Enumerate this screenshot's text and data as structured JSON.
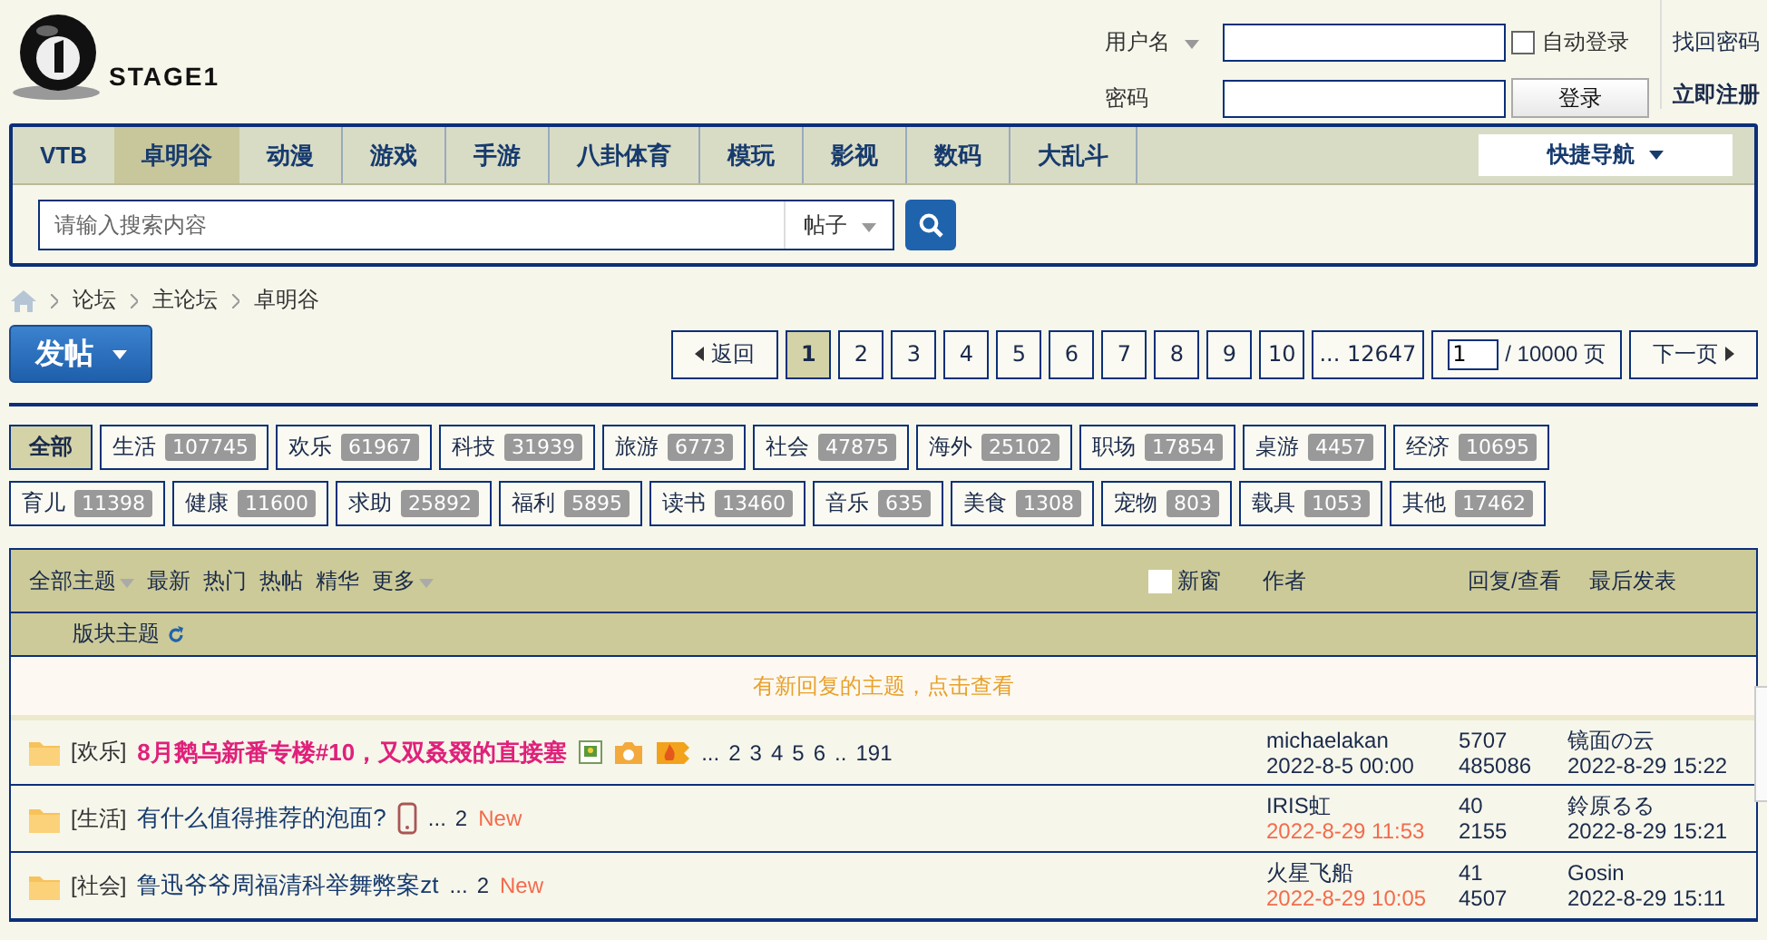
{
  "site": {
    "logo_text": "STAGE1"
  },
  "login": {
    "username_label": "用户名",
    "password_label": "密码",
    "remember_label": "自动登录",
    "remember_checked": false,
    "login_button": "登录",
    "forgot_link": "找回密码",
    "register_link": "立即注册"
  },
  "nav": {
    "items": [
      {
        "label": "VTB",
        "selected": false
      },
      {
        "label": "卓明谷",
        "selected": true
      },
      {
        "label": "动漫",
        "selected": false
      },
      {
        "label": "游戏",
        "selected": false
      },
      {
        "label": "手游",
        "selected": false
      },
      {
        "label": "八卦体育",
        "selected": false
      },
      {
        "label": "模玩",
        "selected": false
      },
      {
        "label": "影视",
        "selected": false
      },
      {
        "label": "数码",
        "selected": false
      },
      {
        "label": "大乱斗",
        "selected": false
      }
    ],
    "quick_nav": "快捷导航"
  },
  "search": {
    "placeholder": "请输入搜索内容",
    "scope": "帖子"
  },
  "breadcrumb": [
    "论坛",
    "主论坛",
    "卓明谷"
  ],
  "post_button": "发帖",
  "pagination": {
    "back": "返回",
    "pages": [
      {
        "label": "1",
        "selected": true
      },
      {
        "label": "2",
        "selected": false
      },
      {
        "label": "3",
        "selected": false
      },
      {
        "label": "4",
        "selected": false
      },
      {
        "label": "5",
        "selected": false
      },
      {
        "label": "6",
        "selected": false
      },
      {
        "label": "7",
        "selected": false
      },
      {
        "label": "8",
        "selected": false
      },
      {
        "label": "9",
        "selected": false
      },
      {
        "label": "10",
        "selected": false
      },
      {
        "label": "... 12647",
        "selected": false
      }
    ],
    "page_input": "1",
    "total": "/ 10000 页",
    "next": "下一页"
  },
  "categories": [
    [
      {
        "label": "全部",
        "selected": true
      },
      {
        "label": "生活",
        "count": "107745",
        "selected": false
      },
      {
        "label": "欢乐",
        "count": "61967",
        "selected": false
      },
      {
        "label": "科技",
        "count": "31939",
        "selected": false
      },
      {
        "label": "旅游",
        "count": "6773",
        "selected": false
      },
      {
        "label": "社会",
        "count": "47875",
        "selected": false
      },
      {
        "label": "海外",
        "count": "25102",
        "selected": false
      },
      {
        "label": "职场",
        "count": "17854",
        "selected": false
      },
      {
        "label": "桌游",
        "count": "4457",
        "selected": false
      },
      {
        "label": "经济",
        "count": "10695",
        "selected": false
      }
    ],
    [
      {
        "label": "育儿",
        "count": "11398",
        "selected": false
      },
      {
        "label": "健康",
        "count": "11600",
        "selected": false
      },
      {
        "label": "求助",
        "count": "25892",
        "selected": false
      },
      {
        "label": "福利",
        "count": "5895",
        "selected": false
      },
      {
        "label": "读书",
        "count": "13460",
        "selected": false
      },
      {
        "label": "音乐",
        "count": "635",
        "selected": false
      },
      {
        "label": "美食",
        "count": "1308",
        "selected": false
      },
      {
        "label": "宠物",
        "count": "803",
        "selected": false
      },
      {
        "label": "载具",
        "count": "1053",
        "selected": false
      },
      {
        "label": "其他",
        "count": "17462",
        "selected": false
      }
    ]
  ],
  "thread_header": {
    "filters": [
      {
        "label": "全部主题",
        "dropdown": true
      },
      {
        "label": "最新",
        "dropdown": false
      },
      {
        "label": "热门",
        "dropdown": false
      },
      {
        "label": "热帖",
        "dropdown": false
      },
      {
        "label": "精华",
        "dropdown": false
      },
      {
        "label": "更多",
        "dropdown": true
      }
    ],
    "new_window_label": "新窗",
    "new_window_checked": false,
    "author": "作者",
    "replies_views": "回复/查看",
    "last_post": "最后发表",
    "section_label": "版块主题",
    "notice": "有新回复的主题，点击查看"
  },
  "threads": [
    {
      "category": "[欢乐]",
      "title": "8月鹅乌新番专楼#10，又双叒叕的直接塞",
      "highlight": true,
      "icons": [
        {
          "kind": "image"
        },
        {
          "kind": "camera"
        },
        {
          "kind": "hot"
        }
      ],
      "pages": [
        "...",
        "2",
        "3",
        "4",
        "5",
        "6",
        "..",
        "191"
      ],
      "author": "michaelakan",
      "date": "2022-8-5 00:00",
      "recent": false,
      "replies": "5707",
      "views": "485086",
      "last_poster": "镜面の云",
      "last_time": "2022-8-29 15:22"
    },
    {
      "category": "[生活]",
      "title": "有什么值得推荐的泡面?",
      "highlight": false,
      "icons": [
        {
          "kind": "mobile"
        }
      ],
      "pages": [
        "...",
        "2"
      ],
      "new_badge": "New",
      "author": "IRIS虹",
      "date": "2022-8-29 11:53",
      "recent": true,
      "replies": "40",
      "views": "2155",
      "last_poster": "鈴原るる",
      "last_time": "2022-8-29 15:21"
    },
    {
      "category": "[社会]",
      "title": "鲁迅爷爷周福清科举舞弊案zt",
      "highlight": false,
      "pages": [
        "...",
        "2"
      ],
      "new_badge": "New",
      "author": "火星飞船",
      "date": "2022-8-29 10:05",
      "recent": true,
      "replies": "41",
      "views": "4507",
      "last_poster": "Gosin",
      "last_time": "2022-8-29 15:11"
    }
  ]
}
